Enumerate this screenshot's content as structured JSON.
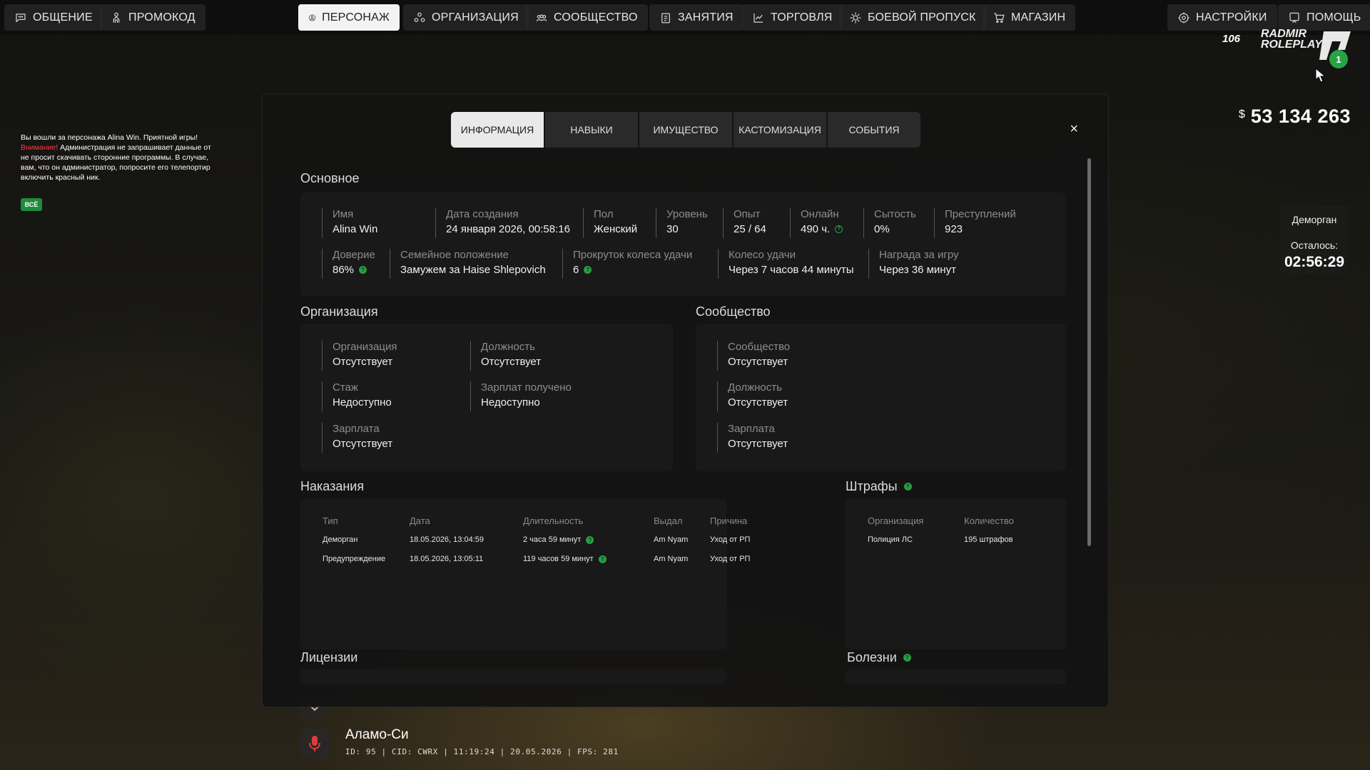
{
  "nav": {
    "left": [
      {
        "label": "ОБЩЕНИЕ",
        "icon": "chat-bubble-icon"
      },
      {
        "label": "ПРОМОКОД",
        "icon": "person-icon"
      }
    ],
    "center": [
      {
        "label": "ПЕРСОНАЖ",
        "icon": "user-circle-icon",
        "active": true
      },
      {
        "label": "ОРГАНИЗАЦИЯ",
        "icon": "organization-icon"
      },
      {
        "label": "СООБЩЕСТВО",
        "icon": "community-icon"
      },
      {
        "label": "ЗАНЯТИЯ",
        "icon": "clipboard-icon"
      },
      {
        "label": "ТОРГОВЛЯ",
        "icon": "chart-icon"
      },
      {
        "label": "БОЕВОЙ ПРОПУСК",
        "icon": "gear-badge-icon"
      },
      {
        "label": "МАГАЗИН",
        "icon": "cart-icon"
      }
    ],
    "right": [
      {
        "label": "НАСТРОЙКИ",
        "icon": "gear-icon"
      },
      {
        "label": "ПОМОЩЬ",
        "icon": "help-icon"
      }
    ]
  },
  "logo": {
    "number": "106",
    "line1": "RADMIR",
    "line2": "ROLEPLAY",
    "badge": "1"
  },
  "money": {
    "sign": "$",
    "value": "53 134 263"
  },
  "timer": {
    "title": "Деморган",
    "left_label": "Осталось:",
    "value": "02:56:29"
  },
  "chat": {
    "line1": "Вы вошли за персонажа Alina Win. Приятной игры!",
    "warn_word": "Внимание!",
    "line2": " Администрация не запрашивает данные от",
    "line3": "не просит скачивать сторонние программы. В случае,",
    "line4": "вам, что он администратор, попросите его телепортир",
    "line5": "включить красный ник.",
    "filter": "ВСЁ"
  },
  "hud": {
    "location": "Аламо-Си",
    "info": "ID: 95 | CID: CWRX | 11:19:24  | 20.05.2026 | FPS: 281"
  },
  "modal": {
    "tabs": [
      "ИНФОРМАЦИЯ",
      "НАВЫКИ",
      "ИМУЩЕСТВО",
      "КАСТОМИЗАЦИЯ",
      "СОБЫТИЯ"
    ],
    "close": "×",
    "basic": {
      "title": "Основное",
      "row1": [
        {
          "label": "Имя",
          "value": "Alina Win"
        },
        {
          "label": "Дата создания",
          "value": "24 января 2026, 00:58:16"
        },
        {
          "label": "Пол",
          "value": "Женский"
        },
        {
          "label": "Уровень",
          "value": "30"
        },
        {
          "label": "Опыт",
          "value": "25 / 64"
        },
        {
          "label": "Онлайн",
          "value": "490 ч."
        },
        {
          "label": "Сытость",
          "value": "0%"
        },
        {
          "label": "Преступлений",
          "value": "923"
        }
      ],
      "row2": [
        {
          "label": "Доверие",
          "value": "86%"
        },
        {
          "label": "Семейное положение",
          "value": "Замужем за Haise Shlepovich"
        },
        {
          "label": "Прокруток колеса удачи",
          "value": "6"
        },
        {
          "label": "Колесо удачи",
          "value": "Через 7 часов 44 минуты"
        },
        {
          "label": "Награда за игру",
          "value": "Через 36 минут"
        }
      ]
    },
    "organization": {
      "title": "Организация",
      "fields": [
        {
          "label": "Организация",
          "value": "Отсутствует"
        },
        {
          "label": "Должность",
          "value": "Отсутствует"
        },
        {
          "label": "Стаж",
          "value": "Недоступно"
        },
        {
          "label": "Зарплат получено",
          "value": "Недоступно"
        },
        {
          "label": "Зарплата",
          "value": "Отсутствует"
        }
      ]
    },
    "community": {
      "title": "Сообщество",
      "fields": [
        {
          "label": "Сообщество",
          "value": "Отсутствует"
        },
        {
          "label": "Должность",
          "value": "Отсутствует"
        },
        {
          "label": "Зарплата",
          "value": "Отсутствует"
        }
      ]
    },
    "punishments": {
      "title": "Наказания",
      "headers": [
        "Тип",
        "Дата",
        "Длительность",
        "Выдал",
        "Причина"
      ],
      "rows": [
        [
          "Деморган",
          "18.05.2026, 13:04:59",
          "2 часа 59 минут",
          "Am Nyam",
          "Уход от РП"
        ],
        [
          "Предупреждение",
          "18.05.2026, 13:05:11",
          "119 часов 59 минут",
          "Am Nyam",
          "Уход от РП"
        ]
      ]
    },
    "fines": {
      "title": "Штрафы",
      "headers": [
        "Организация",
        "Количество"
      ],
      "rows": [
        [
          "Полиция ЛС",
          "195 штрафов"
        ]
      ]
    },
    "licenses": {
      "title": "Лицензии"
    },
    "diseases": {
      "title": "Болезни"
    }
  }
}
